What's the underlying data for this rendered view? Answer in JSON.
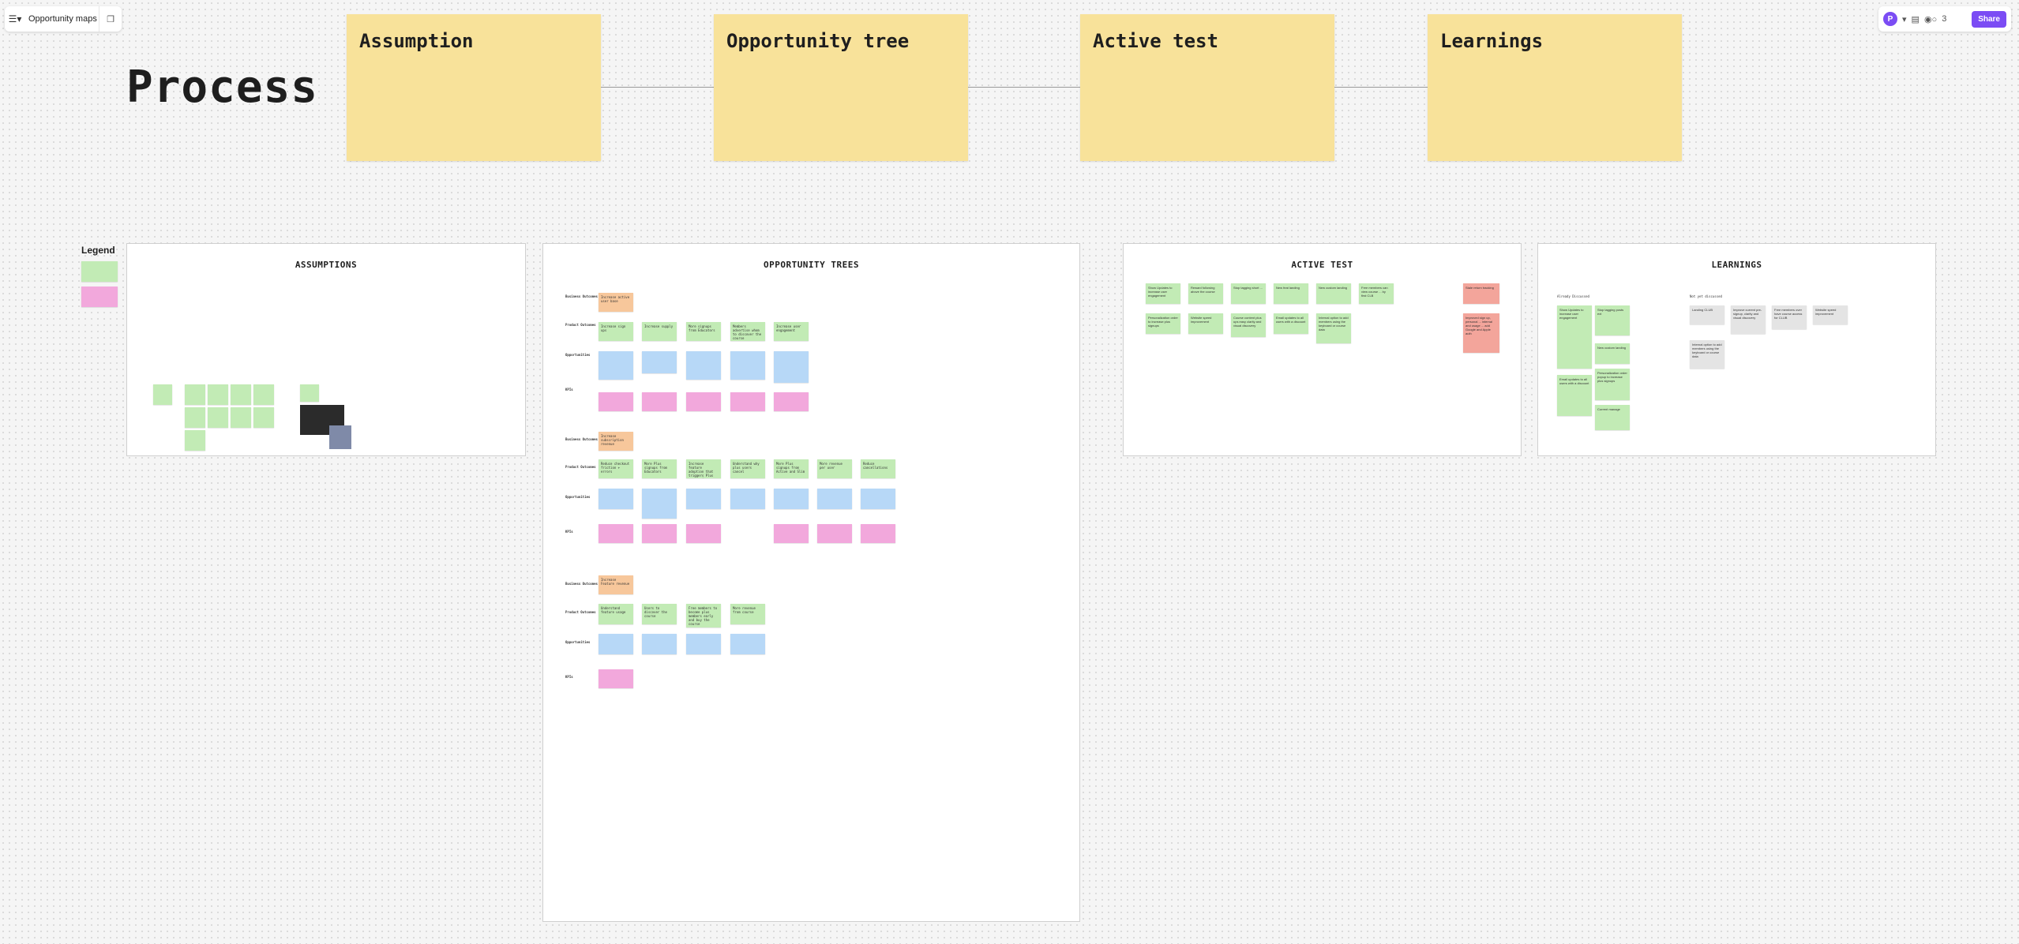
{
  "toolbar": {
    "board_title": "Opportunity maps",
    "avatar_initial": "P",
    "share_label": "Share",
    "collaborator_count": "3"
  },
  "page_title": "Process",
  "process_steps": [
    "Assumption",
    "Opportunity tree",
    "Active test",
    "Learnings"
  ],
  "legend_title": "Legend",
  "frames": {
    "assumptions": "ASSUMPTIONS",
    "opportunity_trees": "OPPORTUNITY TREES",
    "active_test": "ACTIVE TEST",
    "learnings": "LEARNINGS"
  },
  "row_labels": {
    "business_outcomes": "Business Outcomes",
    "product_outcomes": "Product Outcomes",
    "opportunities": "Opportunities",
    "kpis": "KPIs"
  },
  "tree1": {
    "business": "Increase active user base",
    "products": [
      "Increase sign ups",
      "Increase supply",
      "More signups from Educators",
      "Members advertise whom to discover the course",
      "Increase user engagement"
    ]
  },
  "tree2": {
    "business": "Increase subscription revenue",
    "products": [
      "Reduce checkout friction + errors",
      "More Plus signups from Educators",
      "Increase feature adoption that triggers Plus conversion",
      "Understand why plus users cancel",
      "More Plus signups from Active and Slim",
      "More revenue per user",
      "Reduce cancellations"
    ]
  },
  "tree3": {
    "business": "Increase Feature revenue",
    "products": [
      "Understand feature usage",
      "Users to discover the course",
      "Free members to become plus members early and buy the course",
      "More revenue from course"
    ]
  },
  "active_test_notes": [
    "Show Updates to increase user engagement",
    "Reward following above the course",
    "Stop tagging short ...",
    "New feat landing",
    "New custom landing",
    "Free members can view course ... by first CLB",
    "Personalization order to increase plus signups",
    "Website speed improvement",
    "Course content plus ups easy clarity and visual discovery",
    "Email updates to all users with a discount",
    "Internal option to add members using the keyboard or course data"
  ],
  "active_test_red": [
    "Stale return tracking",
    "Improved sign up, personal ... internal and usage ... add Google and Apple auth"
  ],
  "learnings": {
    "col1_label": "Already Discussed",
    "col2_label": "Not yet discussed",
    "notes_green": [
      "Show Updates to increase user engagement",
      "Stop tagging posts ext",
      "New custom landing",
      "Email updates to all users with a discount",
      "Personalization order popup to increase plus signups",
      "Current manage"
    ],
    "notes_gray": [
      "Landing CLUB",
      "Improve current pre-signup, clarity and visual discovery",
      "Free members over have course access for CLUB",
      "Website speed improvement",
      "Internal option to add members using the keyboard or course data"
    ]
  }
}
